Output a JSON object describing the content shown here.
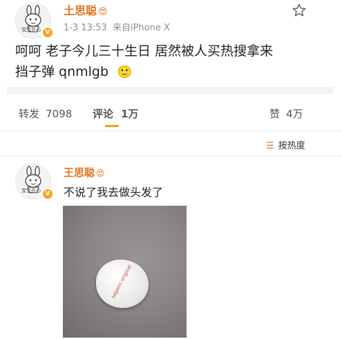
{
  "post": {
    "author": "土思聪",
    "author_badge": "😍",
    "avatar_caption": "宝宝开心",
    "time": "1-3 13:53",
    "source": "来自iPhone X",
    "text_line1": "呵呵 老子今儿三十生日 居然被人买热搜拿来",
    "text_line2": "挡子弹 qnmlgb",
    "emoji": "🙂",
    "star_icon": "star-outline-icon"
  },
  "tabs": {
    "repost_label": "转发",
    "repost_count": "7098",
    "comment_label": "评论",
    "comment_count": "1万",
    "like_label": "赞",
    "like_count": "4万"
  },
  "sort": {
    "label": "按热度",
    "icon": "sort-lines-icon"
  },
  "comment": {
    "author": "王思聪",
    "author_badge": "😍",
    "avatar_caption": "宝宝开心",
    "text": "不说了我去做头发了",
    "photo_label": "sagami original"
  },
  "colors": {
    "name": "#e3741f",
    "accent_underline": "#f39c12",
    "verified_badge": "#f5a623"
  }
}
